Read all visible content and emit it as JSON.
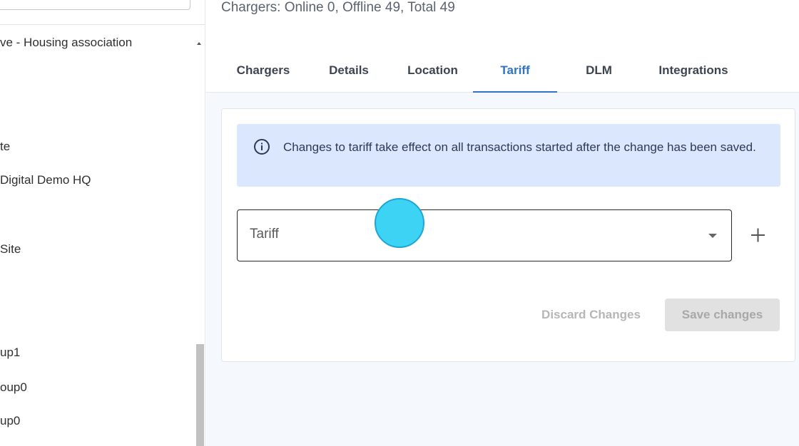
{
  "sidebar": {
    "items": [
      "ve - Housing association",
      "te",
      "Digital Demo HQ",
      "Site",
      "up1",
      "oup0",
      "up0"
    ]
  },
  "header": {
    "counts": "Chargers: Online 0, Offline 49, Total 49"
  },
  "tabs": [
    {
      "label": "Chargers"
    },
    {
      "label": "Details"
    },
    {
      "label": "Location"
    },
    {
      "label": "Tariff"
    },
    {
      "label": "DLM"
    },
    {
      "label": "Integrations"
    }
  ],
  "active_tab": "Tariff",
  "info_banner": {
    "icon": "info-circle-icon",
    "text": "Changes to tariff take effect on all transactions started after the change has been saved."
  },
  "tariff_select": {
    "placeholder": "Tariff",
    "icon": "caret-down-icon"
  },
  "add_button": {
    "icon": "plus-icon"
  },
  "actions": {
    "discard_label": "Discard Changes",
    "save_label": "Save changes"
  },
  "colors": {
    "accent": "#2f73c9",
    "banner_bg": "#dbe7fd",
    "cursor": "#3dd3f5"
  }
}
